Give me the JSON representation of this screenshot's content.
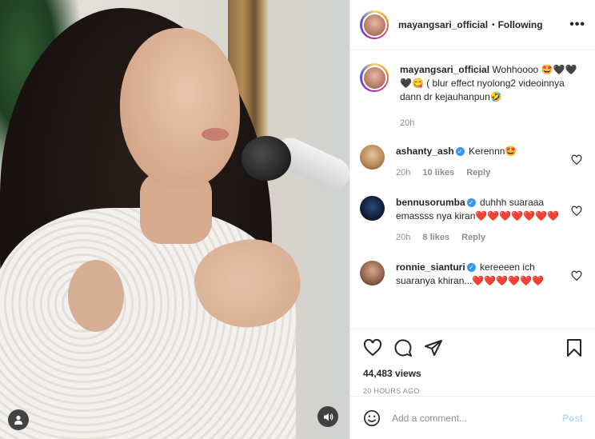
{
  "post": {
    "author": "mayangsari_official",
    "follow_status": "Following",
    "dot": "•",
    "more": "•••",
    "caption": "Wohhoooo 🤩🖤🖤🖤😋 ( blur effect nyolong2 videoinnya dann dr kejauhanpun🤣",
    "caption_time": "20h"
  },
  "comments": [
    {
      "username": "ashanty_ash",
      "verified": true,
      "text": "Kerennn🤩",
      "time": "20h",
      "likes": "10 likes",
      "reply": "Reply",
      "avatar_color": "#c9a06a"
    },
    {
      "username": "bennusorumba",
      "verified": true,
      "text": "duhhh suaraaa emassss nya kiran❤️❤️❤️❤️❤️❤️❤️",
      "time": "20h",
      "likes": "8 likes",
      "reply": "Reply",
      "avatar_color": "#1a2a4a"
    },
    {
      "username": "ronnie_sianturi",
      "verified": true,
      "text": "kereeeen ich suaranya khiran...❤️❤️❤️❤️❤️❤️",
      "avatar_color": "#8d6b5a"
    }
  ],
  "stats": {
    "views": "44,483 views",
    "posted": "20 HOURS AGO"
  },
  "composer": {
    "placeholder": "Add a comment...",
    "post_label": "Post"
  },
  "icons": {
    "header_more": "more-icon",
    "like": "heart-icon",
    "comment": "comment-icon",
    "share": "share-icon",
    "save": "bookmark-icon",
    "emoji": "emoji-icon",
    "video_user": "user-icon",
    "video_sound": "sound-icon"
  },
  "colors": {
    "link": "#3897f0",
    "post_disabled": "#b2dffc",
    "muted": "#8e8e8e"
  }
}
